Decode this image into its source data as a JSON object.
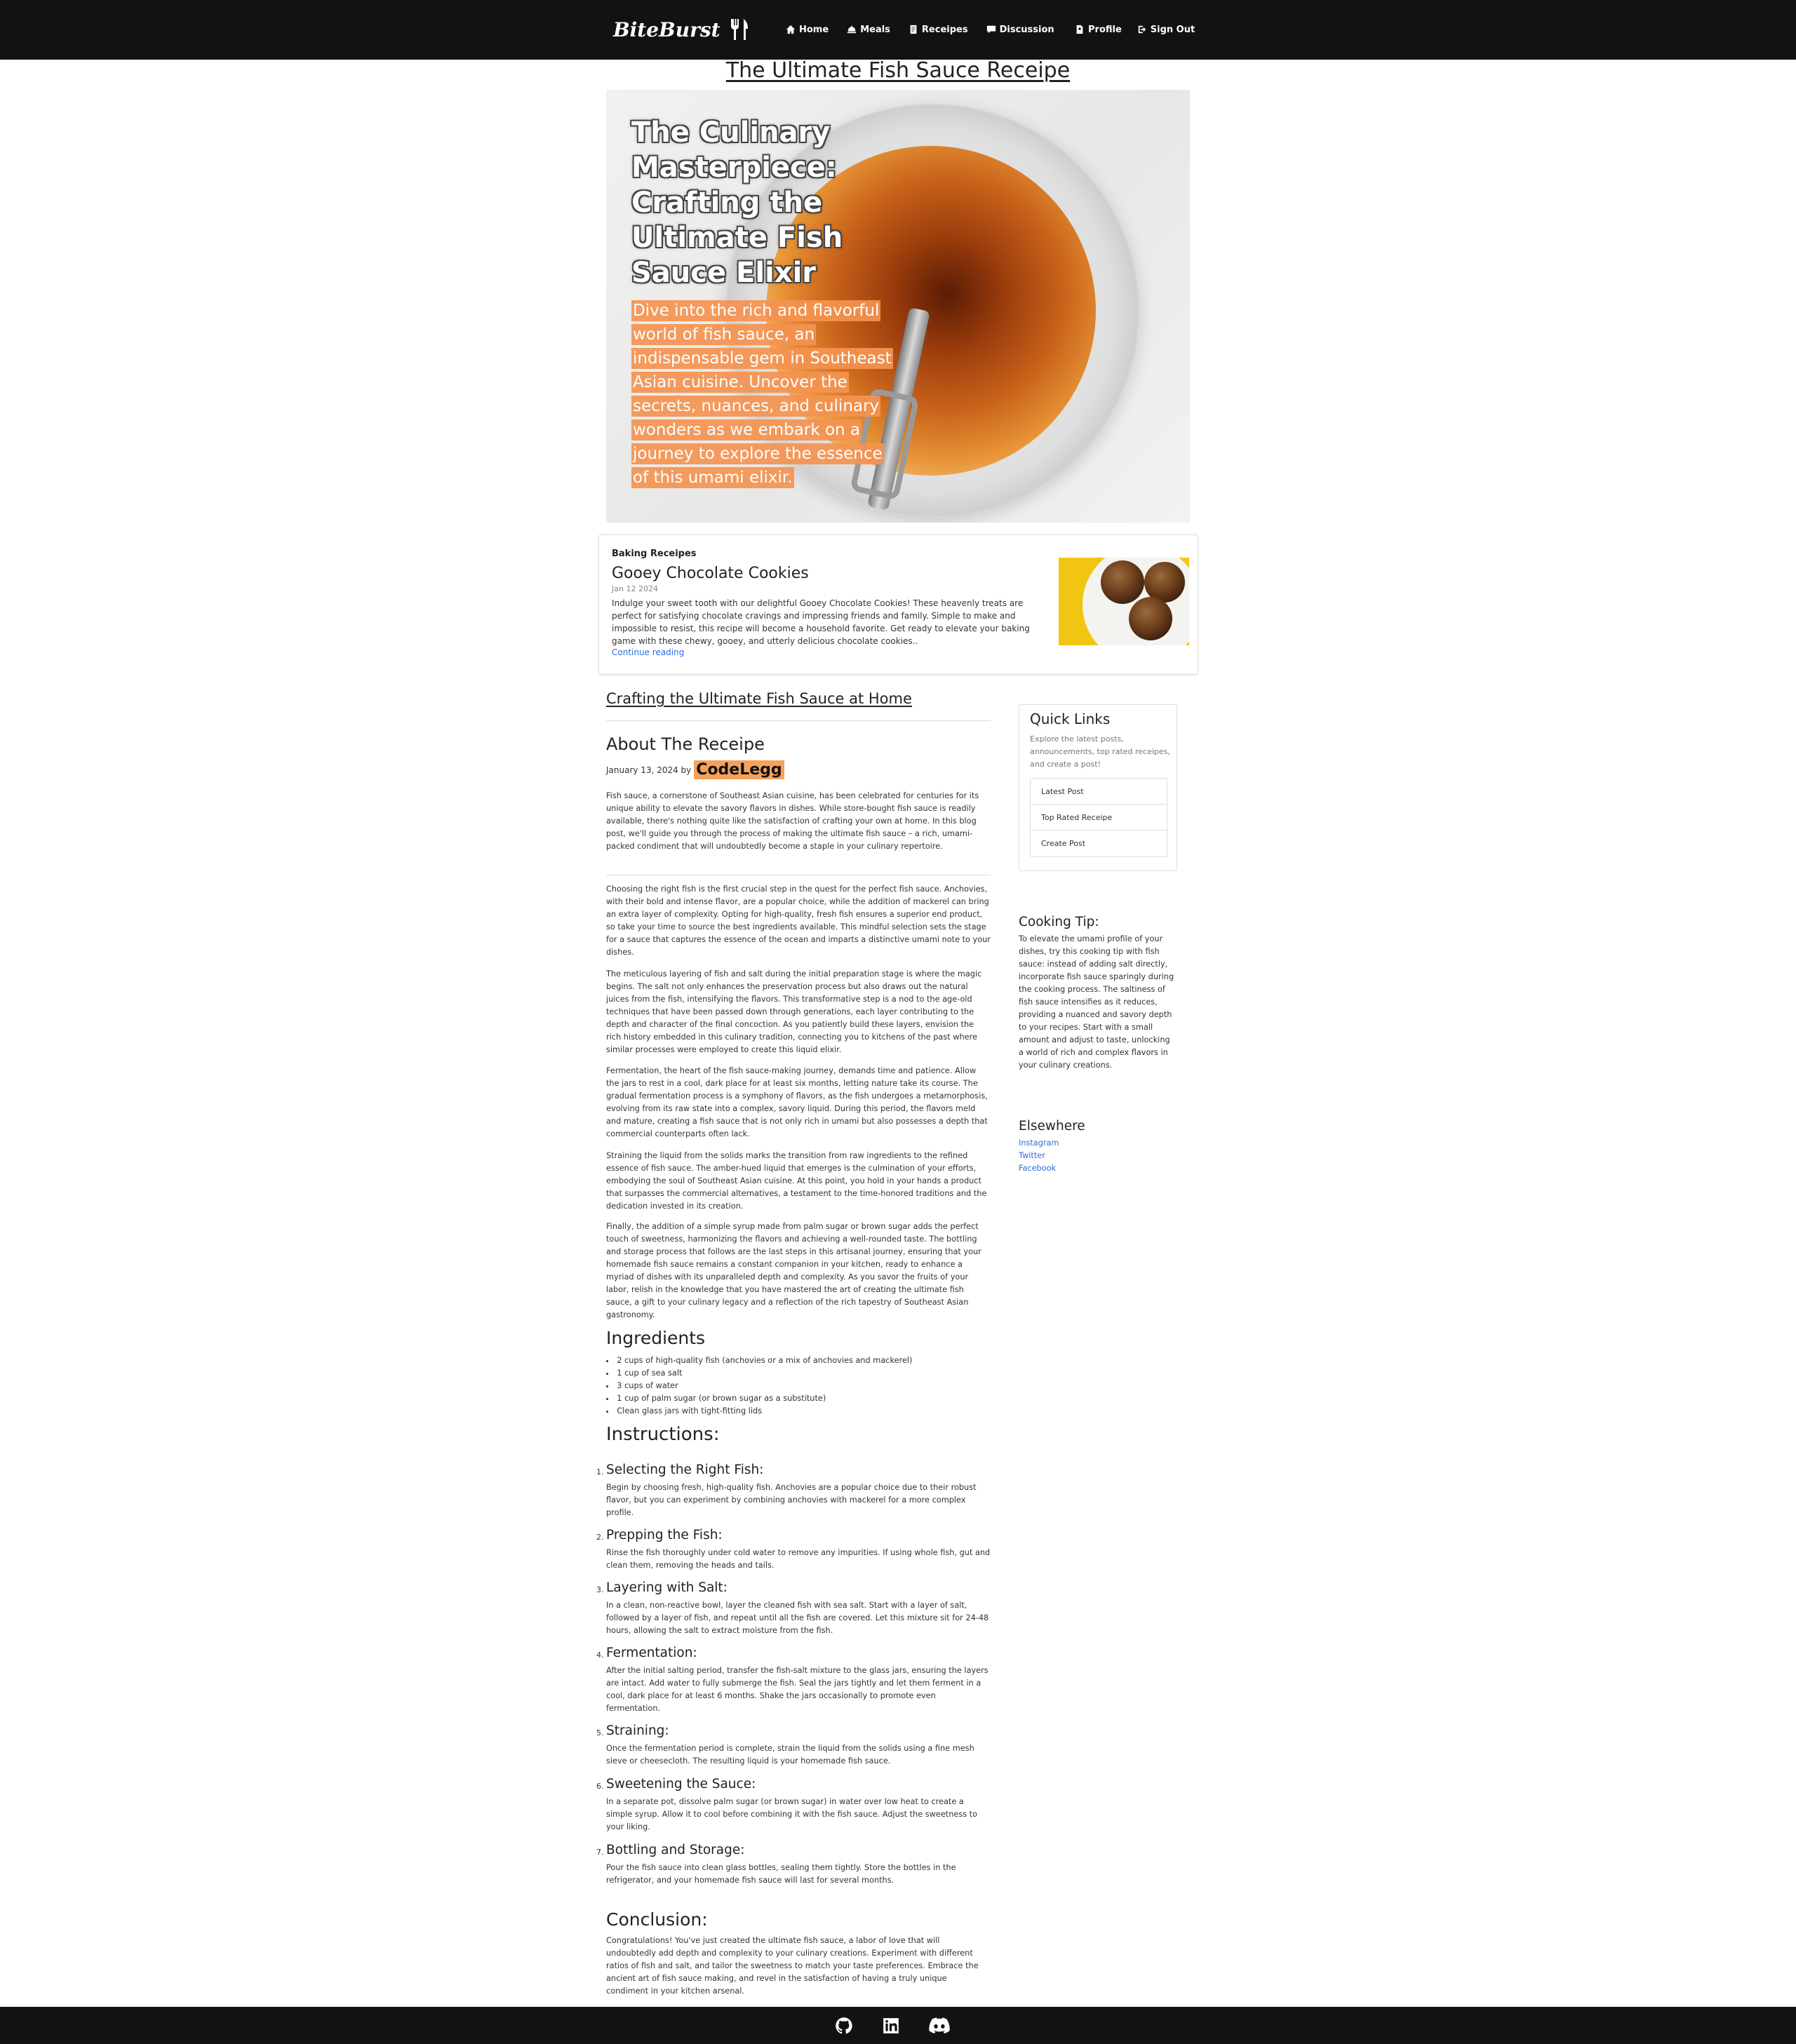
{
  "nav": {
    "brand": "BiteBurst",
    "links": [
      {
        "label": "Home",
        "icon": "home-icon"
      },
      {
        "label": "Meals",
        "icon": "meals-icon"
      },
      {
        "label": "Receipes",
        "icon": "receipes-icon"
      },
      {
        "label": "Discussion",
        "icon": "discussion-icon"
      }
    ],
    "right": [
      {
        "label": "Profile",
        "icon": "profile-icon"
      },
      {
        "label": "Sign Out",
        "icon": "sign-out-icon"
      }
    ]
  },
  "page_title": "The Ultimate Fish Sauce Receipe",
  "hero": {
    "title": "The Culinary Masterpiece: Crafting the Ultimate Fish Sauce Elixir",
    "description": "Dive into the rich and flavorful world of fish sauce, an indispensable gem in Southeast Asian cuisine. Uncover the secrets, nuances, and culinary wonders as we embark on a journey to explore the essence of this umami elixir."
  },
  "featured": {
    "category": "Baking Receipes",
    "title": "Gooey Chocolate Cookies",
    "date": "Jan 12 2024",
    "excerpt": "Indulge your sweet tooth with our delightful Gooey Chocolate Cookies! These heavenly treats are perfect for satisfying chocolate cravings and impressing friends and family. Simple to make and impossible to resist, this recipe will become a household favorite. Get ready to elevate your baking game with these chewy, gooey, and utterly delicious chocolate cookies..",
    "link": "Continue reading"
  },
  "post": {
    "subtitle": "Crafting the Ultimate Fish Sauce at Home",
    "about_heading": "About The Receipe",
    "date_by": "January 13, 2024 by",
    "author": "CodeLegg",
    "intro": "Fish sauce, a cornerstone of Southeast Asian cuisine, has been celebrated for centuries for its unique ability to elevate the savory flavors in dishes. While store-bought fish sauce is readily available, there's nothing quite like the satisfaction of crafting your own at home. In this blog post, we'll guide you through the process of making the ultimate fish sauce – a rich, umami-packed condiment that will undoubtedly become a staple in your culinary repertoire.",
    "paragraphs": [
      "Choosing the right fish is the first crucial step in the quest for the perfect fish sauce. Anchovies, with their bold and intense flavor, are a popular choice, while the addition of mackerel can bring an extra layer of complexity. Opting for high-quality, fresh fish ensures a superior end product, so take your time to source the best ingredients available. This mindful selection sets the stage for a sauce that captures the essence of the ocean and imparts a distinctive umami note to your dishes.",
      "The meticulous layering of fish and salt during the initial preparation stage is where the magic begins. The salt not only enhances the preservation process but also draws out the natural juices from the fish, intensifying the flavors. This transformative step is a nod to the age-old techniques that have been passed down through generations, each layer contributing to the depth and character of the final concoction. As you patiently build these layers, envision the rich history embedded in this culinary tradition, connecting you to kitchens of the past where similar processes were employed to create this liquid elixir.",
      "Fermentation, the heart of the fish sauce-making journey, demands time and patience. Allow the jars to rest in a cool, dark place for at least six months, letting nature take its course. The gradual fermentation process is a symphony of flavors, as the fish undergoes a metamorphosis, evolving from its raw state into a complex, savory liquid. During this period, the flavors meld and mature, creating a fish sauce that is not only rich in umami but also possesses a depth that commercial counterparts often lack.",
      "Straining the liquid from the solids marks the transition from raw ingredients to the refined essence of fish sauce. The amber-hued liquid that emerges is the culmination of your efforts, embodying the soul of Southeast Asian cuisine. At this point, you hold in your hands a product that surpasses the commercial alternatives, a testament to the time-honored traditions and the dedication invested in its creation.",
      "Finally, the addition of a simple syrup made from palm sugar or brown sugar adds the perfect touch of sweetness, harmonizing the flavors and achieving a well-rounded taste. The bottling and storage process that follows are the last steps in this artisanal journey, ensuring that your homemade fish sauce remains a constant companion in your kitchen, ready to enhance a myriad of dishes with its unparalleled depth and complexity. As you savor the fruits of your labor, relish in the knowledge that you have mastered the art of creating the ultimate fish sauce, a gift to your culinary legacy and a reflection of the rich tapestry of Southeast Asian gastronomy."
    ],
    "ingredients_heading": "Ingredients",
    "ingredients": [
      "2 cups of high-quality fish (anchovies or a mix of anchovies and mackerel)",
      "1 cup of sea salt",
      "3 cups of water",
      "1 cup of palm sugar (or brown sugar as a substitute)",
      "Clean glass jars with tight-fitting lids"
    ],
    "instructions_heading": "Instructions:",
    "steps": [
      {
        "num": "1.",
        "title": "Selecting the Right Fish:",
        "text": "Begin by choosing fresh, high-quality fish. Anchovies are a popular choice due to their robust flavor, but you can experiment by combining anchovies with mackerel for a more complex profile."
      },
      {
        "num": "2.",
        "title": "Prepping the Fish:",
        "text": "Rinse the fish thoroughly under cold water to remove any impurities. If using whole fish, gut and clean them, removing the heads and tails."
      },
      {
        "num": "3.",
        "title": "Layering with Salt:",
        "text": "In a clean, non-reactive bowl, layer the cleaned fish with sea salt. Start with a layer of salt, followed by a layer of fish, and repeat until all the fish are covered. Let this mixture sit for 24-48 hours, allowing the salt to extract moisture from the fish."
      },
      {
        "num": "4.",
        "title": "Fermentation:",
        "text": "After the initial salting period, transfer the fish-salt mixture to the glass jars, ensuring the layers are intact. Add water to fully submerge the fish. Seal the jars tightly and let them ferment in a cool, dark place for at least 6 months. Shake the jars occasionally to promote even fermentation."
      },
      {
        "num": "5.",
        "title": "Straining:",
        "text": "Once the fermentation period is complete, strain the liquid from the solids using a fine mesh sieve or cheesecloth. The resulting liquid is your homemade fish sauce."
      },
      {
        "num": "6.",
        "title": "Sweetening the Sauce:",
        "text": "In a separate pot, dissolve palm sugar (or brown sugar) in water over low heat to create a simple syrup. Allow it to cool before combining it with the fish sauce. Adjust the sweetness to your liking."
      },
      {
        "num": "7.",
        "title": "Bottling and Storage:",
        "text": "Pour the fish sauce into clean glass bottles, sealing them tightly. Store the bottles in the refrigerator, and your homemade fish sauce will last for several months."
      }
    ],
    "conclusion_heading": "Conclusion:",
    "conclusion": "Congratulations! You've just created the ultimate fish sauce, a labor of love that will undoubtedly add depth and complexity to your culinary creations. Experiment with different ratios of fish and salt, and tailor the sweetness to match your taste preferences. Embrace the ancient art of fish sauce making, and revel in the satisfaction of having a truly unique condiment in your kitchen arsenal."
  },
  "sidebar": {
    "quick_links_title": "Quick Links",
    "quick_links_desc": "Explore the latest posts, announcements, top rated receipes, and create a post!",
    "quick_links": [
      "Latest Post",
      "Top Rated Receipe",
      "Create Post"
    ],
    "tip_title": "Cooking Tip:",
    "tip_text": "To elevate the umami profile of your dishes, try this cooking tip with fish sauce: instead of adding salt directly, incorporate fish sauce sparingly during the cooking process. The saltiness of fish sauce intensifies as it reduces, providing a nuanced and savory depth to your recipes. Start with a small amount and adjust to taste, unlocking a world of rich and complex flavors in your culinary creations.",
    "elsewhere_title": "Elsewhere",
    "elsewhere_links": [
      "Instagram",
      "Twitter",
      "Facebook"
    ]
  },
  "footer": {
    "icons": [
      "github-icon",
      "linkedin-icon",
      "discord-icon"
    ]
  },
  "colors": {
    "nav_bg": "#121212",
    "accent_orange": "#f5a25a",
    "link_blue": "#2d6cdf"
  }
}
